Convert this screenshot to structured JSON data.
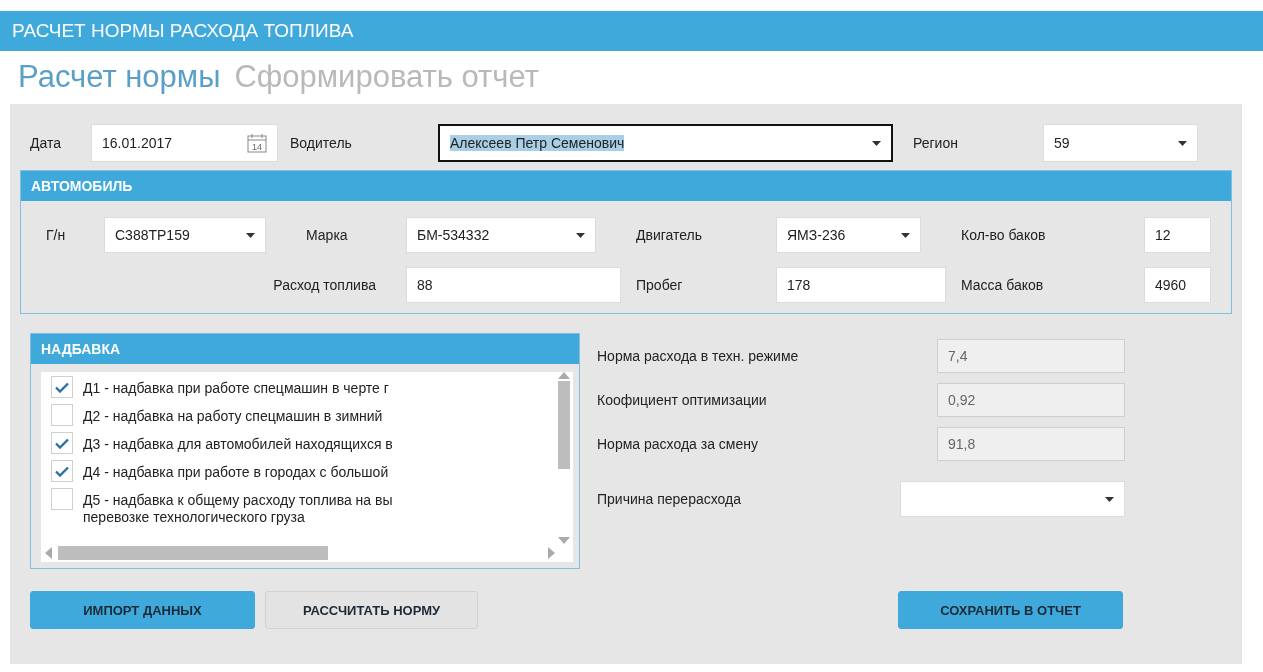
{
  "app_title": "РАСЧЕТ НОРМЫ РАСХОДА ТОПЛИВА",
  "tabs": [
    {
      "label": "Расчет нормы",
      "selected": true
    },
    {
      "label": "Сформировать отчет",
      "selected": false
    }
  ],
  "date": {
    "label": "Дата",
    "value": "16.01.2017",
    "calendar_day": "14"
  },
  "driver": {
    "label": "Водитель",
    "value": "Алексеев Петр Семенович",
    "focused": true,
    "text_selected": true
  },
  "region": {
    "label": "Регион",
    "value": "59"
  },
  "vehicle": {
    "title": "АВТОМОБИЛЬ",
    "row_1": [
      {
        "kind": "combo",
        "label": "Г/н",
        "value": "С388ТР159"
      },
      {
        "kind": "combo",
        "label": "Марка",
        "value": "БМ-534332"
      },
      {
        "kind": "combo",
        "label": "Двигатель",
        "value": "ЯМЗ-236"
      },
      {
        "kind": "text",
        "label": "Кол-во баков",
        "value": "12"
      }
    ],
    "row_2": [
      {
        "kind": "text",
        "label": "Расход топлива",
        "value": "88"
      },
      {
        "kind": "text",
        "label": "Пробег",
        "value": "178"
      },
      {
        "kind": "text",
        "label": "Масса баков",
        "value": "4960"
      }
    ]
  },
  "surcharge": {
    "title": "НАДБАВКА",
    "items": [
      {
        "text": "Д1 - надбавка при работе спецмашин в черте г",
        "checked": true
      },
      {
        "text": "Д2 - надбавка на работу спецмашин в зимний",
        "checked": false
      },
      {
        "text": "Д3 - надбавка для автомобилей находящихся в",
        "checked": true
      },
      {
        "text": "Д4 - надбавка при работе в городах с большой",
        "checked": true
      },
      {
        "text": "Д5 - надбавка к общему расходу топлива на вы\nперевозке технологического груза",
        "checked": false
      }
    ]
  },
  "results": [
    {
      "label": "Норма расхода в техн. режиме",
      "value": "7,4"
    },
    {
      "label": "Коофициент оптимизации",
      "value": "0,92"
    },
    {
      "label": "Норма расхода за смену",
      "value": "91,8"
    }
  ],
  "overspend": {
    "label": "Причина перерасхода"
  },
  "buttons": [
    {
      "label": "ИМПОРТ ДАННЫХ",
      "kind": "primary"
    },
    {
      "label": "РАССЧИТАТЬ НОРМУ",
      "kind": "secondary"
    },
    {
      "label": "СОХРАНИТЬ В ОТЧЕТ",
      "kind": "primary"
    }
  ]
}
